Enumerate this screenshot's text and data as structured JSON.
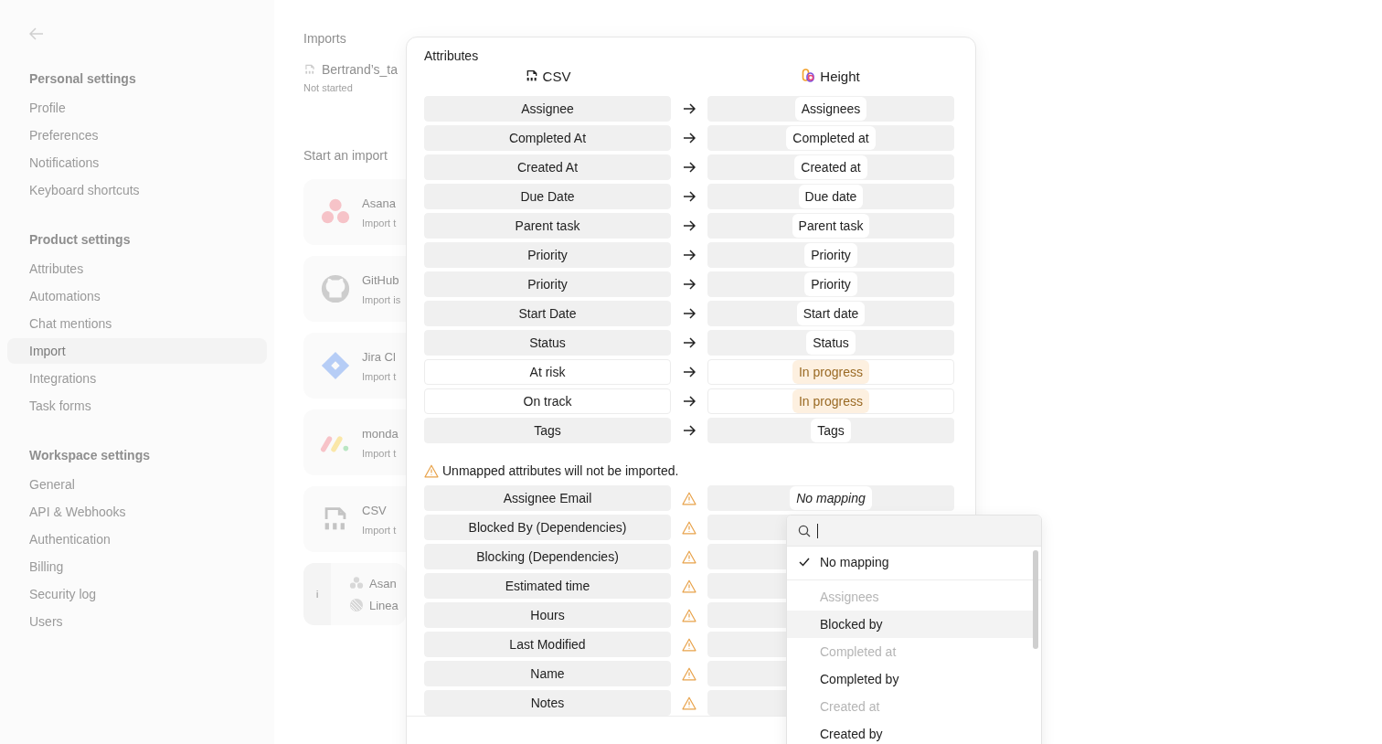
{
  "sidebar": {
    "sections": [
      {
        "title": "Personal settings",
        "items": [
          {
            "label": "Profile",
            "selected": false
          },
          {
            "label": "Preferences",
            "selected": false
          },
          {
            "label": "Notifications",
            "selected": false
          },
          {
            "label": "Keyboard shortcuts",
            "selected": false
          }
        ]
      },
      {
        "title": "Product settings",
        "items": [
          {
            "label": "Attributes",
            "selected": false
          },
          {
            "label": "Automations",
            "selected": false
          },
          {
            "label": "Chat mentions",
            "selected": false
          },
          {
            "label": "Import",
            "selected": true
          },
          {
            "label": "Integrations",
            "selected": false
          },
          {
            "label": "Task forms",
            "selected": false
          }
        ]
      },
      {
        "title": "Workspace settings",
        "items": [
          {
            "label": "General",
            "selected": false
          },
          {
            "label": "API & Webhooks",
            "selected": false
          },
          {
            "label": "Authentication",
            "selected": false
          },
          {
            "label": "Billing",
            "selected": false
          },
          {
            "label": "Security log",
            "selected": false
          },
          {
            "label": "Users",
            "selected": false
          }
        ]
      }
    ]
  },
  "imports": {
    "title": "Imports",
    "items": [
      {
        "name": "Bertrand’s_ta",
        "status": "Not started"
      }
    ]
  },
  "start_import": {
    "title": "Start an import",
    "sources": [
      {
        "kind": "asana",
        "name": "Asana",
        "description": "Import t"
      },
      {
        "kind": "github",
        "name": "GitHub",
        "description": "Import is"
      },
      {
        "kind": "jira",
        "name": "Jira Cl",
        "description": "Import t"
      },
      {
        "kind": "monday",
        "name": "monda",
        "description": "Import t"
      },
      {
        "kind": "csv",
        "name": "CSV",
        "description": "Import t"
      }
    ],
    "more": {
      "badge": "i",
      "items": [
        {
          "kind": "asana",
          "name": "Asan"
        },
        {
          "kind": "linear",
          "name": "Linea"
        }
      ]
    }
  },
  "dialog": {
    "title": "Attributes",
    "source_header": "CSV",
    "target_header": "Height",
    "mapped": [
      {
        "kind": "field",
        "source": "Assignee",
        "target": "Assignees"
      },
      {
        "kind": "field",
        "source": "Completed At",
        "target": "Completed at"
      },
      {
        "kind": "field",
        "source": "Created At",
        "target": "Created at"
      },
      {
        "kind": "field",
        "source": "Due Date",
        "target": "Due date"
      },
      {
        "kind": "field",
        "source": "Parent task",
        "target": "Parent task"
      },
      {
        "kind": "field",
        "source": "Priority",
        "target": "Priority"
      },
      {
        "kind": "field",
        "source": "Priority",
        "target": "Priority"
      },
      {
        "kind": "field",
        "source": "Start Date",
        "target": "Start date"
      },
      {
        "kind": "field",
        "source": "Status",
        "target": "Status"
      },
      {
        "kind": "value",
        "source": "At risk",
        "target": "In progress"
      },
      {
        "kind": "value",
        "source": "On track",
        "target": "In progress"
      },
      {
        "kind": "field",
        "source": "Tags",
        "target": "Tags"
      }
    ],
    "warning": "Unmapped attributes will not be imported.",
    "unmapped": [
      {
        "source": "Assignee Email",
        "target": "No mapping"
      },
      {
        "source": "Blocked By (Dependencies)"
      },
      {
        "source": "Blocking (Dependencies)"
      },
      {
        "source": "Estimated time"
      },
      {
        "source": "Hours"
      },
      {
        "source": "Last Modified"
      },
      {
        "source": "Name"
      },
      {
        "source": "Notes"
      }
    ]
  },
  "dropdown": {
    "items": [
      {
        "label": "No mapping",
        "checked": true,
        "disabled": false,
        "selected": false
      },
      {
        "label": "Assignees",
        "checked": false,
        "disabled": true,
        "selected": false
      },
      {
        "label": "Blocked by",
        "checked": false,
        "disabled": false,
        "selected": true
      },
      {
        "label": "Completed at",
        "checked": false,
        "disabled": true,
        "selected": false
      },
      {
        "label": "Completed by",
        "checked": false,
        "disabled": false,
        "selected": false
      },
      {
        "label": "Created at",
        "checked": false,
        "disabled": true,
        "selected": false
      },
      {
        "label": "Created by",
        "checked": false,
        "disabled": false,
        "selected": false
      }
    ]
  }
}
